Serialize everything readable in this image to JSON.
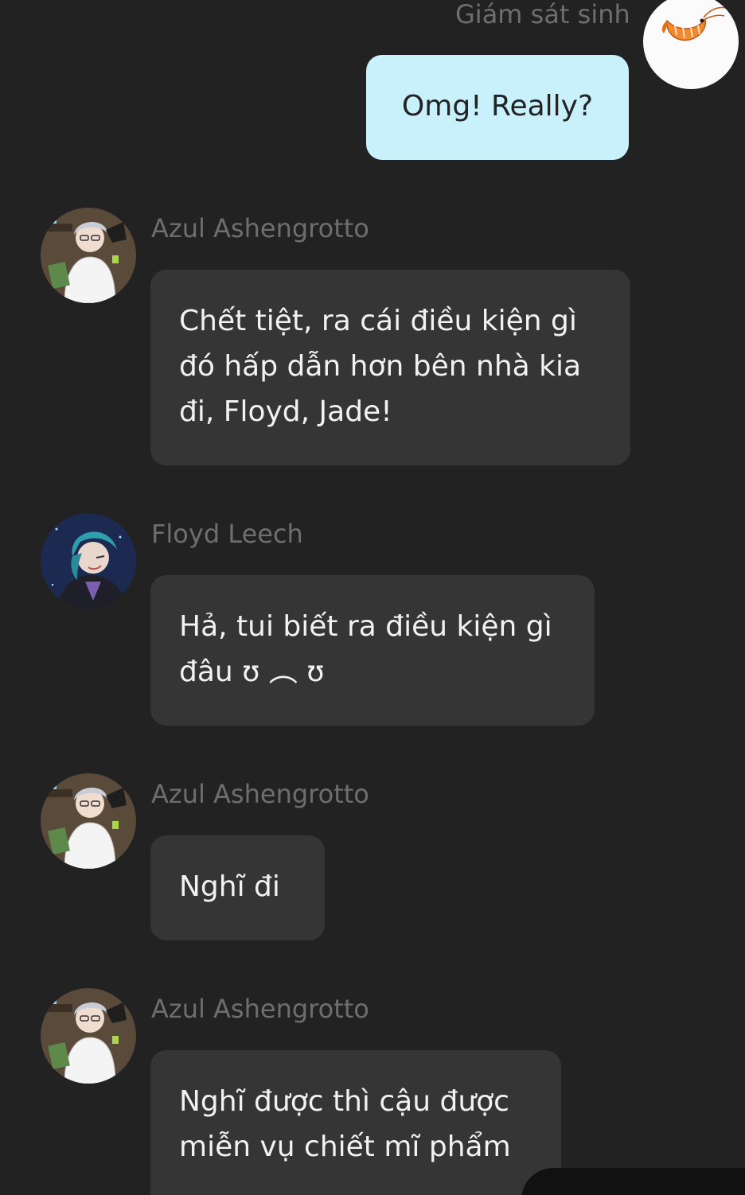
{
  "self": {
    "name": "Giám sát sinh",
    "avatar_icon": "shrimp-icon",
    "message": "Omg! Really?"
  },
  "messages": [
    {
      "sender": "Azul Ashengrotto",
      "avatar_icon": "azul-avatar",
      "lines": [
        "Chết tiệt, ra cái điều kiện gì",
        "đó hấp dẫn hơn bên nhà kia",
        "đi, Floyd, Jade!"
      ]
    },
    {
      "sender": "Floyd Leech",
      "avatar_icon": "floyd-avatar",
      "lines": [
        "Hả, tui biết ra điều kiện gì",
        "đâu ʊ ︵ ʊ"
      ]
    },
    {
      "sender": "Azul Ashengrotto",
      "avatar_icon": "azul-avatar",
      "lines": [
        "Nghĩ đi"
      ]
    },
    {
      "sender": "Azul Ashengrotto",
      "avatar_icon": "azul-avatar",
      "lines": [
        "Nghĩ được thì cậu được",
        "miễn vụ chiết mĩ phẩm"
      ]
    }
  ],
  "colors": {
    "background": "#222222",
    "incoming_bubble": "#353535",
    "outgoing_bubble": "#c9f1fb",
    "sender_name": "#6e6e6e"
  }
}
